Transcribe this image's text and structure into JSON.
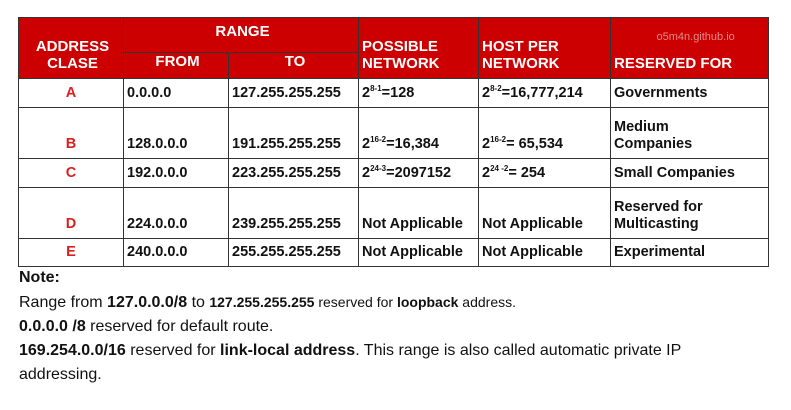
{
  "headers": {
    "address_class": [
      "ADDRESS",
      "CLASE"
    ],
    "range": "RANGE",
    "from": "FROM",
    "to": "TO",
    "possible_network": [
      "POSSIBLE",
      "NETWORK"
    ],
    "host_per_network": [
      "HOST PER",
      "NETWORK"
    ],
    "reserved_for": "RESERVED FOR",
    "watermark": "o5m4n.github.io"
  },
  "rows": [
    {
      "cls": "A",
      "from": "0.0.0.0",
      "to": "127.255.255.255",
      "net_base": "2",
      "net_exp": "8-1",
      "net_val": "=128",
      "host_base": "2",
      "host_exp": "8-2",
      "host_val": "=16,777,214",
      "reserved": [
        "Governments"
      ]
    },
    {
      "cls": "B",
      "from": "128.0.0.0",
      "to": "191.255.255.255",
      "net_base": "2",
      "net_exp": "16-2",
      "net_val": "=16,384",
      "host_base": "2",
      "host_exp": "16-2",
      "host_val": "= 65,534",
      "reserved": [
        "Medium",
        "Companies"
      ]
    },
    {
      "cls": "C",
      "from": "192.0.0.0",
      "to": "223.255.255.255",
      "net_base": "2",
      "net_exp": "24-3",
      "net_val": "=2097152",
      "host_base": "2",
      "host_exp": "24 -2",
      "host_val": "= 254",
      "reserved": [
        "Small Companies"
      ]
    },
    {
      "cls": "D",
      "from": "224.0.0.0",
      "to": "239.255.255.255",
      "net_text": "Not Applicable",
      "host_text": "Not Applicable",
      "reserved": [
        "Reserved for",
        "Multicasting"
      ]
    },
    {
      "cls": "E",
      "from": "240.0.0.0",
      "to": "255.255.255.255",
      "net_text": "Not Applicable",
      "host_text": "Not Applicable",
      "reserved": [
        "Experimental"
      ]
    }
  ],
  "note": {
    "heading": "Note:",
    "line1": {
      "a": "Range from ",
      "b": "127.0.0.0/8",
      "c": " to ",
      "d": "127.255.255.255",
      "e": " reserved for ",
      "f": "loopback",
      "g": " address."
    },
    "line2": {
      "a": "0.0.0.0 /8",
      "b": " reserved for default route."
    },
    "line3": {
      "a": "169.254.0.0/16",
      "b": " reserved for ",
      "c": "link-local address",
      "d": ". This range is also called automatic private IP"
    },
    "line4": "addressing."
  }
}
